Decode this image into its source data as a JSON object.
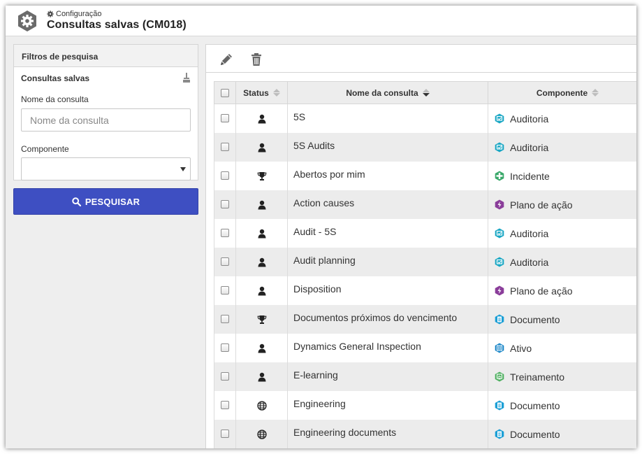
{
  "header": {
    "breadcrumb": "Configuração",
    "title": "Consultas salvas (CM018)"
  },
  "filters": {
    "panel_title": "Filtros de pesquisa",
    "section_title": "Consultas salvas",
    "name_label": "Nome da consulta",
    "name_placeholder": "Nome da consulta",
    "name_value": "",
    "component_label": "Componente",
    "component_value": "",
    "search_button": "PESQUISAR"
  },
  "toolbar": {
    "edit_icon": "pencil-icon",
    "delete_icon": "trash-icon"
  },
  "table": {
    "columns": [
      "Status",
      "Nome da consulta",
      "Componente"
    ],
    "rows": [
      {
        "status": "user",
        "name": "5S",
        "component": "Auditoria"
      },
      {
        "status": "user",
        "name": "5S Audits",
        "component": "Auditoria"
      },
      {
        "status": "trophy",
        "name": "Abertos por mim",
        "component": "Incidente"
      },
      {
        "status": "user",
        "name": "Action causes",
        "component": "Plano de ação"
      },
      {
        "status": "user",
        "name": "Audit - 5S",
        "component": "Auditoria"
      },
      {
        "status": "user",
        "name": "Audit planning",
        "component": "Auditoria"
      },
      {
        "status": "user",
        "name": "Disposition",
        "component": "Plano de ação"
      },
      {
        "status": "trophy",
        "name": "Documentos próximos do vencimento",
        "component": "Documento"
      },
      {
        "status": "user",
        "name": "Dynamics General Inspection",
        "component": "Ativo"
      },
      {
        "status": "user",
        "name": "E-learning",
        "component": "Treinamento"
      },
      {
        "status": "globe",
        "name": "Engineering",
        "component": "Documento"
      },
      {
        "status": "globe",
        "name": "Engineering documents",
        "component": "Documento"
      }
    ]
  },
  "colors": {
    "primary_button": "#3e4fc2",
    "auditoria": "#1aa7c4",
    "incidente": "#3aa86a",
    "plano_de_acao": "#8a3d9a",
    "documento": "#1b9fd6",
    "ativo": "#1a86c8",
    "treinamento": "#4fb061"
  }
}
